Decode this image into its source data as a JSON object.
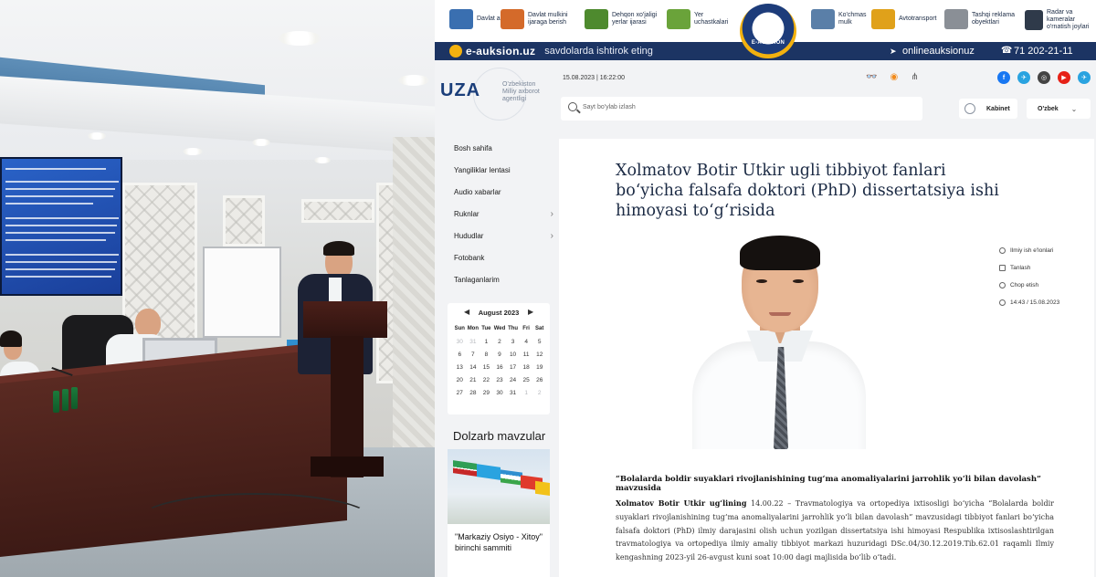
{
  "ad": {
    "items": [
      {
        "label": "Davlat aktivlari",
        "icon": "building-icon",
        "color": "#3a6fb0"
      },
      {
        "label": "Davlat mulkini ijaraga berish",
        "icon": "handshake-icon",
        "color": "#d46a2a"
      },
      {
        "label": "Dehqon xo'jaligi yerlar ijarasi",
        "icon": "field-icon",
        "color": "#4e8a2e"
      },
      {
        "label": "Yer uchastkalari",
        "icon": "land-icon",
        "color": "#6aa33a"
      },
      {
        "label": "Ko'chmas mulk",
        "icon": "house-icon",
        "color": "#5a7fa8"
      },
      {
        "label": "Avtotransport",
        "icon": "car-icon",
        "color": "#e0a11a"
      },
      {
        "label": "Tashqi reklama obyektlari",
        "icon": "billboard-icon",
        "color": "#8a8f96"
      },
      {
        "label": "Radar va kameralar o'rnatish joylari",
        "icon": "camera-icon",
        "color": "#2f3a4a"
      }
    ],
    "logo_text": "E-AUKSION",
    "brand": "e-auksion.uz",
    "slogan": "savdolarda ishtirok eting",
    "site": "onlineauksionuz",
    "phone": "71 202-21-11"
  },
  "header": {
    "logo": "UZA",
    "logo_sub": "O'zbekiston Milliy axborot agentligi",
    "datetime": "15.08.2023 | 16:22:00",
    "search_placeholder": "Sayt bo'ylab izlash",
    "kabinet": "Kabinet",
    "lang": "O'zbek",
    "social": [
      {
        "name": "facebook",
        "color": "#1877f2",
        "glyph": "f"
      },
      {
        "name": "telegram",
        "color": "#2aa3e0",
        "glyph": "t"
      },
      {
        "name": "instagram",
        "color": "#444444",
        "glyph": "i"
      },
      {
        "name": "youtube",
        "color": "#e62117",
        "glyph": "▶"
      },
      {
        "name": "telegram2",
        "color": "#2aa3e0",
        "glyph": "✈"
      }
    ]
  },
  "sidebar": {
    "items": [
      {
        "label": "Bosh sahifa",
        "chev": ""
      },
      {
        "label": "Yangiliklar lentasi",
        "chev": ""
      },
      {
        "label": "Audio xabarlar",
        "chev": ""
      },
      {
        "label": "Ruknlar",
        "chev": "›"
      },
      {
        "label": "Hududlar",
        "chev": "›"
      },
      {
        "label": "Fotobank",
        "chev": ""
      },
      {
        "label": "Tanlaganlarim",
        "chev": ""
      }
    ]
  },
  "calendar": {
    "month": "August 2023",
    "days_of_week": [
      "Sun",
      "Mon",
      "Tue",
      "Wed",
      "Thu",
      "Fri",
      "Sat"
    ],
    "cells": [
      {
        "d": "30",
        "m": true
      },
      {
        "d": "31",
        "m": true
      },
      {
        "d": "1"
      },
      {
        "d": "2"
      },
      {
        "d": "3"
      },
      {
        "d": "4"
      },
      {
        "d": "5"
      },
      {
        "d": "6"
      },
      {
        "d": "7"
      },
      {
        "d": "8"
      },
      {
        "d": "9"
      },
      {
        "d": "10"
      },
      {
        "d": "11"
      },
      {
        "d": "12"
      },
      {
        "d": "13"
      },
      {
        "d": "14"
      },
      {
        "d": "15"
      },
      {
        "d": "16"
      },
      {
        "d": "17"
      },
      {
        "d": "18"
      },
      {
        "d": "19"
      },
      {
        "d": "20"
      },
      {
        "d": "21"
      },
      {
        "d": "22"
      },
      {
        "d": "23"
      },
      {
        "d": "24"
      },
      {
        "d": "25"
      },
      {
        "d": "26"
      },
      {
        "d": "27"
      },
      {
        "d": "28"
      },
      {
        "d": "29"
      },
      {
        "d": "30"
      },
      {
        "d": "31"
      },
      {
        "d": "1",
        "m": true
      },
      {
        "d": "2",
        "m": true
      }
    ]
  },
  "dolzarb": {
    "title": "Dolzarb mavzular",
    "card_title": "\"Markaziy Osiyo - Xitoy\" birinchi sammiti"
  },
  "article": {
    "title": "Xolmatov Botir Utkir ugli tibbiyot fanlari bo‘yicha falsafa doktori (PhD) dissertatsiya ishi himoyasi to‘g‘risida",
    "meta": [
      {
        "label": "Ilmiy ish e'lonlari",
        "icon": "category-icon"
      },
      {
        "label": "Tanlash",
        "icon": "bookmark-icon"
      },
      {
        "label": "Chop etish",
        "icon": "print-icon"
      },
      {
        "label": "14:43 / 15.08.2023",
        "icon": "clock-icon"
      }
    ],
    "lead": "“Bolalarda boldir suyaklari rivojlanishining tug‘ma anomaliyalarini jarrohlik yo‘li bilan davolash” mavzusida",
    "body_name": "Xolmatov Botir Utkir ug‘lining",
    "body_text": " 14.00.22 – Travmatologiya va ortopediya ixtisosligi bo‘yicha “Bolalarda boldir suyaklari rivojlanishining tug‘ma anomaliyalarini jarrohlik yo‘li bilan davolash” mavzusidagi tibbiyot fanlari bo‘yicha falsafa doktori (PhD) ilmiy darajasini olish uchun yozilgan dissertatsiya ishi himoyasi Respublika ixtisoslashtirilgan travmatologiya va ortopediya ilmiy amaliy tibbiyot markazi huzuridagi DSc.04/30.12.2019.Tib.62.01 raqamli Ilmiy kengashning 2023-yil 26-avgust kuni soat 10:00 dagi majlisida bo‘lib o‘tadi."
  }
}
